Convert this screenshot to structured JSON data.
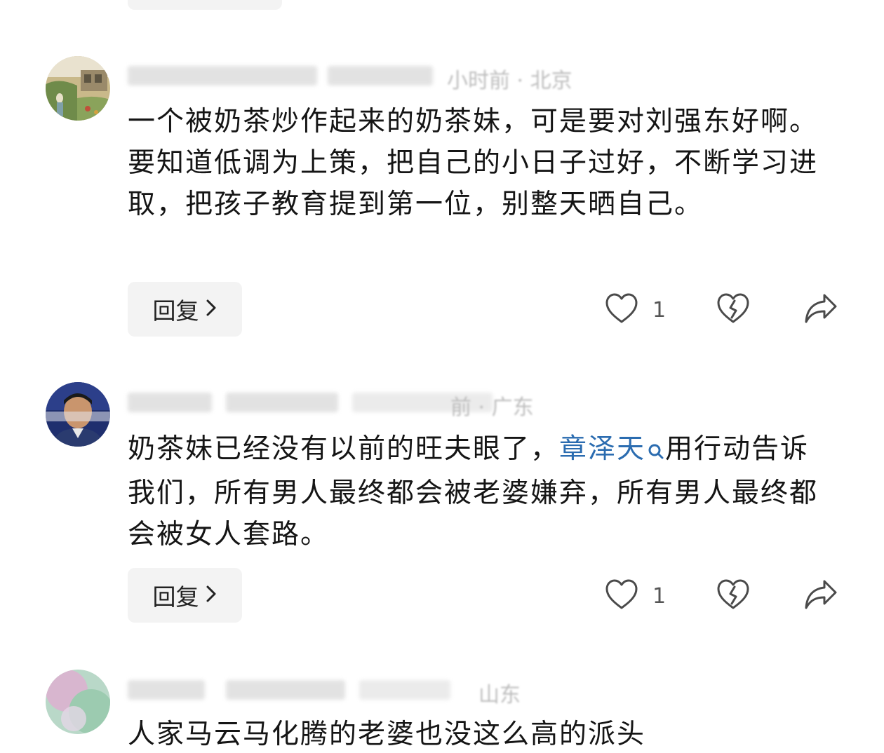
{
  "comments": [
    {
      "author_blurred": "█████ ████",
      "meta_tail": "小时前 · 北京",
      "text": "一个被奶茶炒作起来的奶茶妹，可是要对刘强东好啊。要知道低调为上策，把自己的小日子过好，不断学习进取，把孩子教育提到第一位，别整天晒自己。",
      "reply_label": "回复",
      "like_count": "1"
    },
    {
      "author_blurred": "████ ████",
      "meta_tail": "前 · 广东",
      "text_before": "奶茶妹已经没有以前的旺夫眼了，",
      "mention": "章泽天",
      "text_after": "用行动告诉我们，所有男人最终都会被老婆嫌弃，所有男人最终都会被女人套路。",
      "reply_label": "回复",
      "like_count": "1"
    },
    {
      "author_blurred": "████ ████",
      "meta_tail": "山东",
      "text": "人家马云马化腾的老婆也没这么高的派头"
    }
  ],
  "icons": {
    "like": "heart-icon",
    "dislike": "broken-heart-icon",
    "share": "share-arrow-icon",
    "mention_search": "search-icon",
    "reply_chevron": "chevron-right-icon"
  },
  "colors": {
    "mention": "#2b6cb0",
    "reply_bg": "#f3f3f3",
    "text": "#151515",
    "icon": "#4a4a4a"
  }
}
